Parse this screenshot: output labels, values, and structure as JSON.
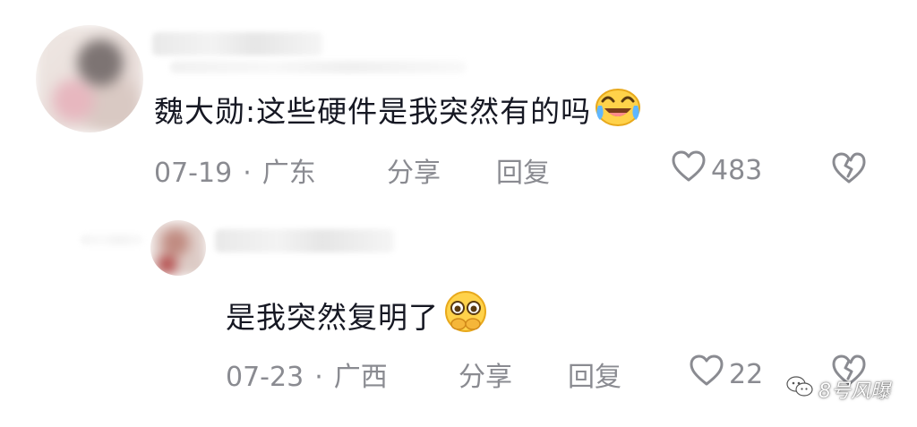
{
  "comments": [
    {
      "text": "魏大勋:这些硬件是我突然有的吗",
      "emoji": "crying-laughing-face-icon",
      "date": "07-19",
      "location": "广东",
      "share_label": "分享",
      "reply_label": "回复",
      "like_count": "483"
    },
    {
      "text": "是我突然复明了",
      "emoji": "holding-back-tears-face-icon",
      "date": "07-23",
      "location": "广西",
      "share_label": "分享",
      "reply_label": "回复",
      "like_count": "22"
    }
  ],
  "separator": "·",
  "watermark": {
    "text": "8号风曝",
    "icon": "wechat-logo-icon"
  },
  "colors": {
    "text": "#161823",
    "meta": "#8a8b91",
    "background": "#ffffff"
  }
}
